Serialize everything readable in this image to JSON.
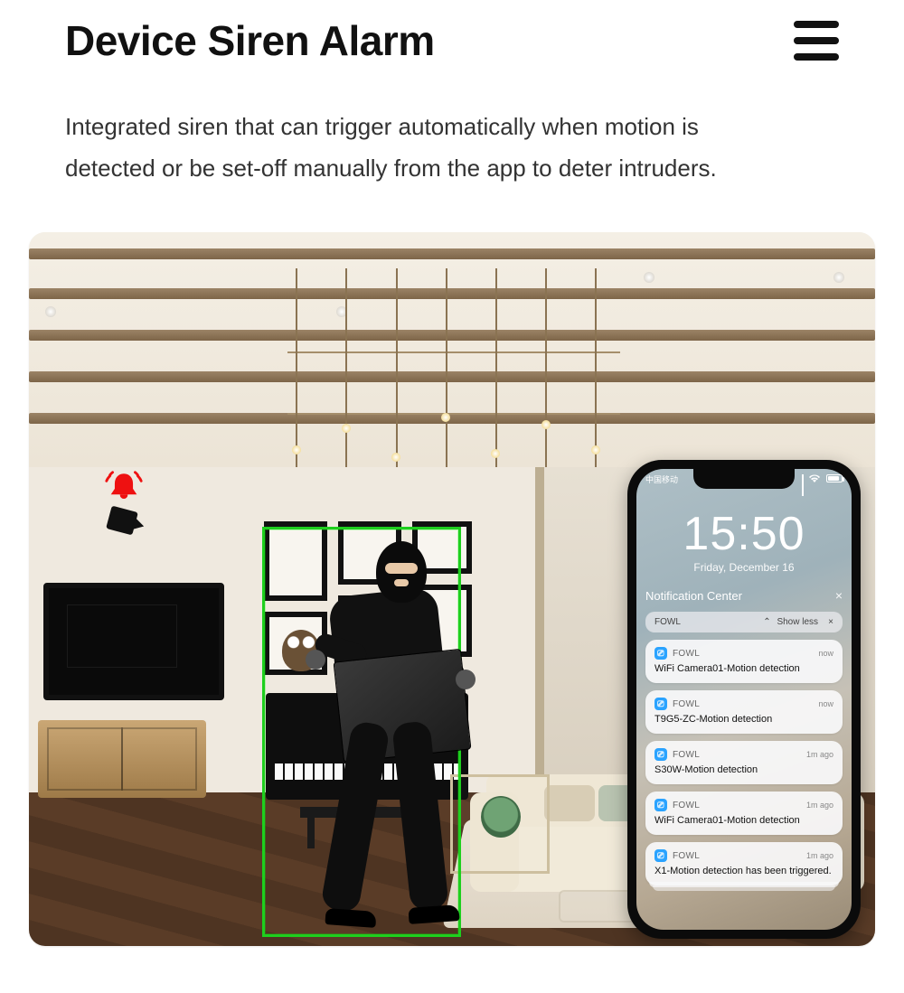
{
  "header": {
    "title": "Device Siren Alarm"
  },
  "subtitle": "Integrated siren that can trigger automatically when motion is detected or be set-off manually from the app to deter intruders.",
  "scene": {
    "alarm_icon": "bell-alarm-icon",
    "detection_box_color": "#1ecf1e"
  },
  "phone": {
    "status_bar": {
      "carrier": "中国移动"
    },
    "clock": {
      "time": "15:50",
      "date": "Friday, December 16"
    },
    "notification_center": {
      "title": "Notification Center",
      "close": "×"
    },
    "group": {
      "app": "FOWL",
      "show_less": "Show less",
      "close": "×"
    },
    "notifications": [
      {
        "app": "FOWL",
        "time": "now",
        "message": "WiFi Camera01-Motion detection"
      },
      {
        "app": "FOWL",
        "time": "now",
        "message": "T9G5-ZC-Motion detection"
      },
      {
        "app": "FOWL",
        "time": "1m ago",
        "message": "S30W-Motion detection"
      },
      {
        "app": "FOWL",
        "time": "1m ago",
        "message": "WiFi Camera01-Motion detection"
      },
      {
        "app": "FOWL",
        "time": "1m ago",
        "message": "X1-Motion detection has been triggered."
      }
    ]
  }
}
